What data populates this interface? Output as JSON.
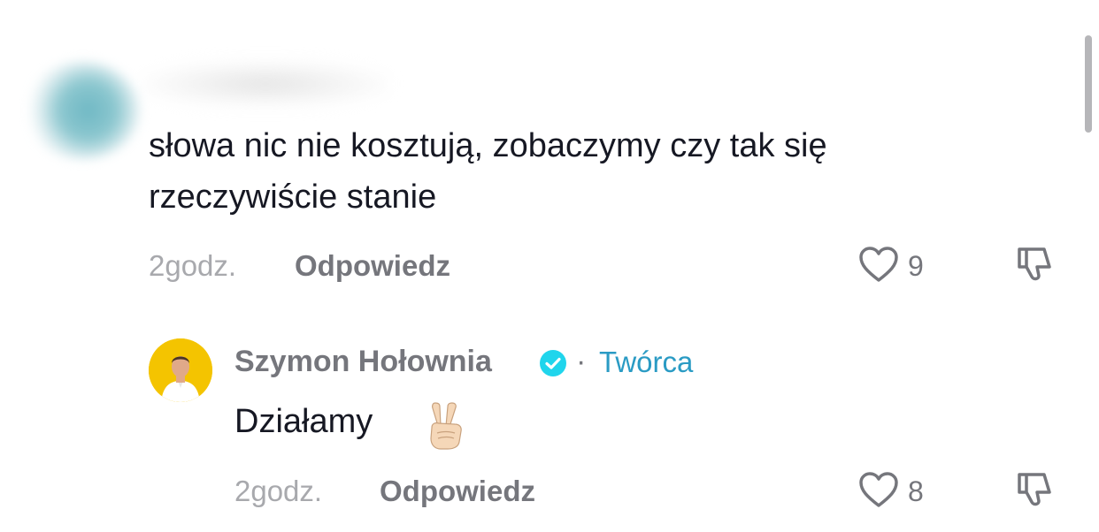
{
  "comments": [
    {
      "author_name": "",
      "text": "słowa nic nie kosztują, zobaczymy czy tak się\nrzeczywiście stanie",
      "time": "2godz.",
      "reply_label": "Odpowiedz",
      "likes": "9"
    },
    {
      "author_name": "Szymon Hołownia",
      "verified": true,
      "separator": "·",
      "creator_label": "Twórca",
      "text": "Działamy",
      "emoji": "victory-hand-emoji",
      "time": "2godz.",
      "reply_label": "Odpowiedz",
      "likes": "8"
    }
  ],
  "colors": {
    "text": "#161823",
    "muted": "#75767c",
    "time": "#a8a9ad",
    "creator": "#2a9bc4",
    "verified": "#20d5ec",
    "avatar_bg": "#f4c400"
  }
}
